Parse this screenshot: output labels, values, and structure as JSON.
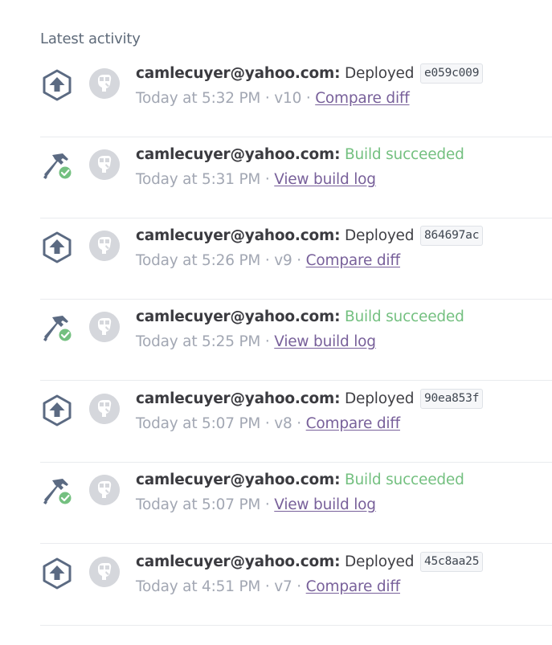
{
  "section_title": "Latest activity",
  "separator": "·",
  "colors": {
    "build_success": "#74c080",
    "link": "#78609a",
    "icon": "#5b6a82",
    "check": "#74c080",
    "avatar_bg": "#d5d7dc"
  },
  "activities": [
    {
      "type": "deploy",
      "icon": "deploy-icon",
      "user": "camlecuyer@yahoo.com:",
      "action": "Deployed",
      "commit": "e059c009",
      "time": "Today at 5:32 PM",
      "version": "v10",
      "link": "Compare diff"
    },
    {
      "type": "build",
      "icon": "build-hammer-icon",
      "user": "camlecuyer@yahoo.com:",
      "action": "Build succeeded",
      "commit": "",
      "time": "Today at 5:31 PM",
      "version": "",
      "link": "View build log"
    },
    {
      "type": "deploy",
      "icon": "deploy-icon",
      "user": "camlecuyer@yahoo.com:",
      "action": "Deployed",
      "commit": "864697ac",
      "time": "Today at 5:26 PM",
      "version": "v9",
      "link": "Compare diff"
    },
    {
      "type": "build",
      "icon": "build-hammer-icon",
      "user": "camlecuyer@yahoo.com:",
      "action": "Build succeeded",
      "commit": "",
      "time": "Today at 5:25 PM",
      "version": "",
      "link": "View build log"
    },
    {
      "type": "deploy",
      "icon": "deploy-icon",
      "user": "camlecuyer@yahoo.com:",
      "action": "Deployed",
      "commit": "90ea853f",
      "time": "Today at 5:07 PM",
      "version": "v8",
      "link": "Compare diff"
    },
    {
      "type": "build",
      "icon": "build-hammer-icon",
      "user": "camlecuyer@yahoo.com:",
      "action": "Build succeeded",
      "commit": "",
      "time": "Today at 5:07 PM",
      "version": "",
      "link": "View build log"
    },
    {
      "type": "deploy",
      "icon": "deploy-icon",
      "user": "camlecuyer@yahoo.com:",
      "action": "Deployed",
      "commit": "45c8aa25",
      "time": "Today at 4:51 PM",
      "version": "v7",
      "link": "Compare diff"
    }
  ]
}
